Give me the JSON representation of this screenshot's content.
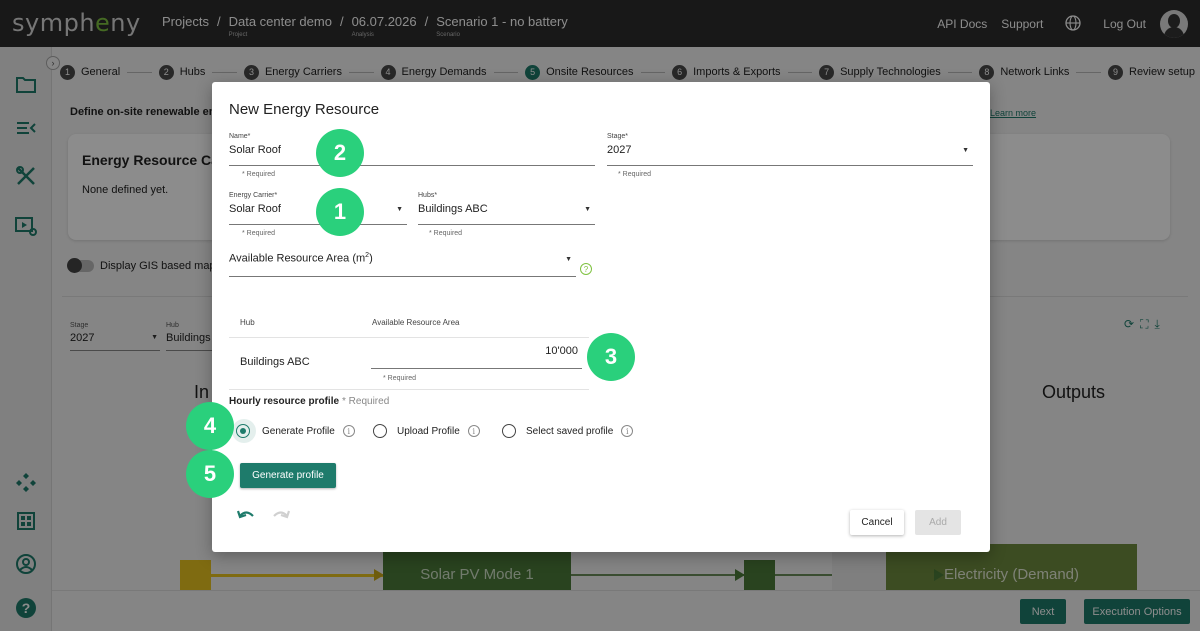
{
  "app": {
    "logo_pre": "symph",
    "logo_e": "e",
    "logo_post": "ny"
  },
  "breadcrumbs": [
    {
      "label": "Projects",
      "sub": ""
    },
    {
      "label": "Data center demo",
      "sub": "Project"
    },
    {
      "label": "06.07.2026",
      "sub": "Analysis"
    },
    {
      "label": "Scenario 1 - no battery",
      "sub": "Scenario"
    }
  ],
  "header": {
    "api_docs": "API Docs",
    "support": "Support",
    "log_out": "Log Out"
  },
  "steps": [
    {
      "num": "1",
      "label": "General"
    },
    {
      "num": "2",
      "label": "Hubs"
    },
    {
      "num": "3",
      "label": "Energy Carriers"
    },
    {
      "num": "4",
      "label": "Energy Demands"
    },
    {
      "num": "5",
      "label": "Onsite Resources",
      "active": true
    },
    {
      "num": "6",
      "label": "Imports & Exports"
    },
    {
      "num": "7",
      "label": "Supply Technologies"
    },
    {
      "num": "8",
      "label": "Network Links"
    },
    {
      "num": "9",
      "label": "Review setup"
    }
  ],
  "background": {
    "description": "Define on-site renewable energ",
    "learn_more": "Learn more",
    "card_title": "Energy Resource Ca",
    "card_text": "None defined yet.",
    "gis_toggle": "Display GIS based map",
    "stage_label": "Stage",
    "stage_value": "2027",
    "hub_label": "Hub",
    "hub_value": "Buildings",
    "inputs_label": "In",
    "outputs_label": "Outputs",
    "flow_box1": "Solar PV Mode 1",
    "flow_box2": "Electricity (Demand)"
  },
  "footer": {
    "next": "Next",
    "execution_options": "Execution Options"
  },
  "modal": {
    "title": "New Energy Resource",
    "name_label": "Name*",
    "name_value": "Solar Roof",
    "stage_label": "Stage*",
    "stage_value": "2027",
    "carrier_label": "Energy Carrier*",
    "carrier_value": "Solar Roof",
    "hubs_label": "Hubs*",
    "hubs_value": "Buildings ABC",
    "required": "* Required",
    "area_label_pre": "Available Resource Area (m",
    "area_label_sup": "2",
    "area_label_post": ")",
    "table": {
      "col_hub": "Hub",
      "col_area": "Available Resource Area",
      "row_hub": "Buildings ABC",
      "row_area": "10'000"
    },
    "profile_title": "Hourly resource profile",
    "profile_required": "* Required",
    "options": [
      "Generate Profile",
      "Upload Profile",
      "Select saved profile"
    ],
    "generate_button": "Generate profile",
    "cancel": "Cancel",
    "add": "Add"
  },
  "annotations": [
    "1",
    "2",
    "3",
    "4",
    "5"
  ],
  "colors": {
    "accent": "#1e7b6b",
    "badge": "#2ad07c",
    "solar": "#e8c31f",
    "pv": "#4b7a3a"
  }
}
